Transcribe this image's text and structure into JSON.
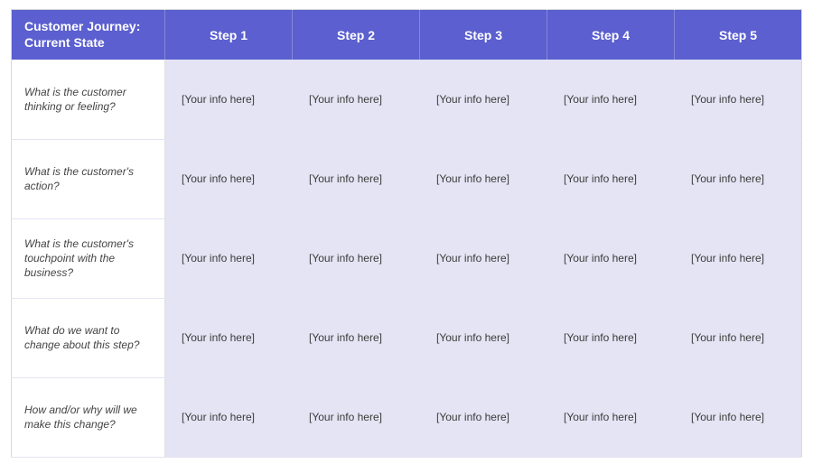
{
  "header": {
    "title": "Customer Journey:\nCurrent State",
    "steps": [
      "Step 1",
      "Step 2",
      "Step 3",
      "Step 4",
      "Step 5"
    ]
  },
  "rows": [
    {
      "label": "What is the customer thinking or feeling?",
      "cells": [
        "[Your info here]",
        "[Your info here]",
        "[Your info here]",
        "[Your info here]",
        "[Your info here]"
      ]
    },
    {
      "label": "What is the customer's action?",
      "cells": [
        "[Your info here]",
        "[Your info here]",
        "[Your info here]",
        "[Your info here]",
        "[Your info here]"
      ]
    },
    {
      "label": "What is the customer's touchpoint with the business?",
      "cells": [
        "[Your info here]",
        "[Your info here]",
        "[Your info here]",
        "[Your info here]",
        "[Your info here]"
      ]
    },
    {
      "label": "What do we want to change about this step?",
      "cells": [
        "[Your info here]",
        "[Your info here]",
        "[Your info here]",
        "[Your info here]",
        "[Your info here]"
      ]
    },
    {
      "label": "How and/or why will we make this change?",
      "cells": [
        "[Your info here]",
        "[Your info here]",
        "[Your info here]",
        "[Your info here]",
        "[Your info here]"
      ]
    }
  ]
}
